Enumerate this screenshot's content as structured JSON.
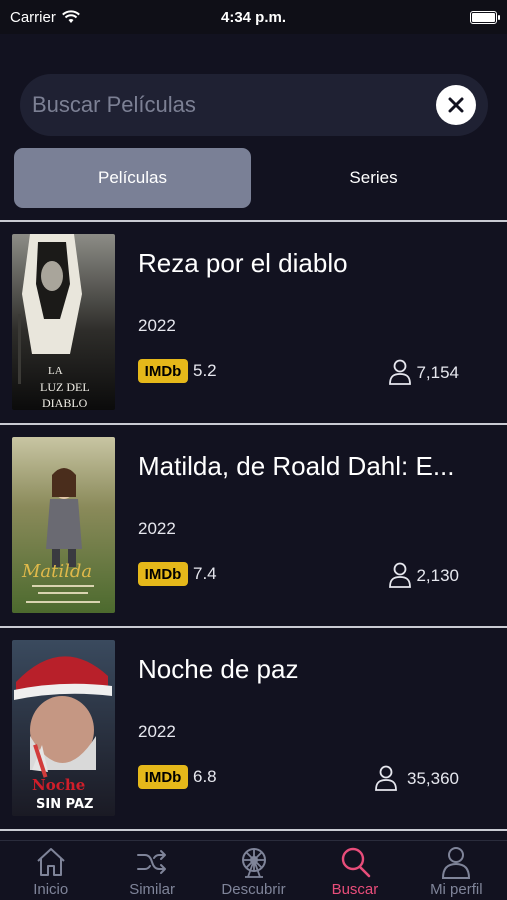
{
  "status_bar": {
    "carrier": "Carrier",
    "time": "4:34 p.m."
  },
  "search": {
    "placeholder": "Buscar Películas",
    "value": ""
  },
  "tabs": [
    {
      "label": "Películas",
      "active": true
    },
    {
      "label": "Series",
      "active": false
    }
  ],
  "movies": [
    {
      "title": "Reza por el diablo",
      "year": "2022",
      "imdb_label": "IMDb",
      "rating": "5.2",
      "votes": "7,154",
      "poster_text": [
        "LA",
        "LUZ DEL",
        "DIABLO"
      ]
    },
    {
      "title": "Matilda, de Roald Dahl: E...",
      "year": "2022",
      "imdb_label": "IMDb",
      "rating": "7.4",
      "votes": "2,130",
      "poster_text": [
        "Matilda"
      ]
    },
    {
      "title": "Noche de paz",
      "year": "2022",
      "imdb_label": "IMDb",
      "rating": "6.8",
      "votes": "35,360",
      "poster_text": [
        "Noche",
        "SIN PAZ"
      ]
    }
  ],
  "nav": [
    {
      "label": "Inicio",
      "icon": "home-icon",
      "active": false
    },
    {
      "label": "Similar",
      "icon": "shuffle-icon",
      "active": false
    },
    {
      "label": "Descubrir",
      "icon": "ferris-wheel-icon",
      "active": false
    },
    {
      "label": "Buscar",
      "icon": "search-icon",
      "active": true
    },
    {
      "label": "Mi perfil",
      "icon": "profile-icon",
      "active": false
    }
  ],
  "colors": {
    "background": "#121220",
    "active_tab": "#7a8096",
    "accent": "#e84d7a",
    "imdb": "#e5b81a"
  }
}
